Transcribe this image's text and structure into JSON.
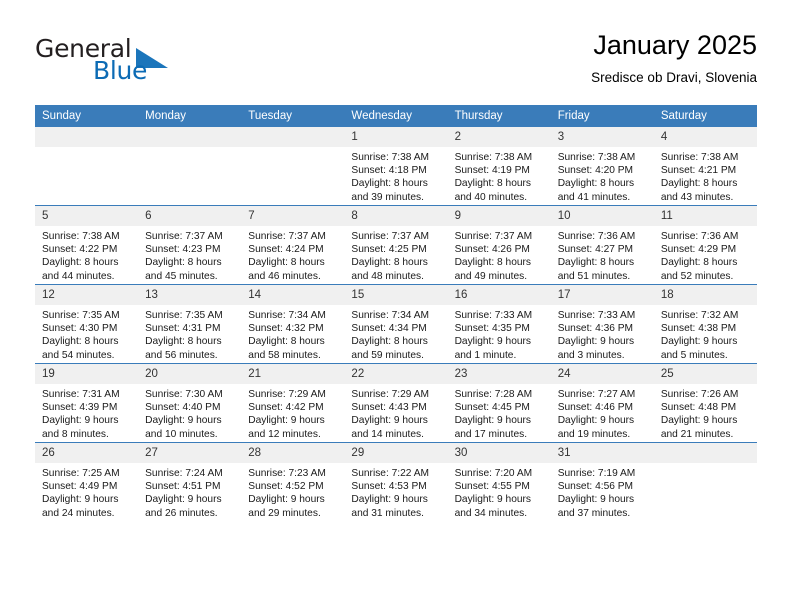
{
  "brand": {
    "name_part1": "General",
    "name_part2": "Blue",
    "accent_color": "#1b75bb"
  },
  "header": {
    "title": "January 2025",
    "subtitle": "Sredisce ob Dravi, Slovenia"
  },
  "theme": {
    "header_row_bg": "#3a7cba",
    "daynum_bg": "#f0f0f0",
    "page_bg": "#ffffff"
  },
  "weekdays": [
    "Sunday",
    "Monday",
    "Tuesday",
    "Wednesday",
    "Thursday",
    "Friday",
    "Saturday"
  ],
  "weeks": [
    [
      {
        "empty": true
      },
      {
        "empty": true
      },
      {
        "empty": true
      },
      {
        "day": "1",
        "sunrise": "Sunrise: 7:38 AM",
        "sunset": "Sunset: 4:18 PM",
        "daylight1": "Daylight: 8 hours",
        "daylight2": "and 39 minutes."
      },
      {
        "day": "2",
        "sunrise": "Sunrise: 7:38 AM",
        "sunset": "Sunset: 4:19 PM",
        "daylight1": "Daylight: 8 hours",
        "daylight2": "and 40 minutes."
      },
      {
        "day": "3",
        "sunrise": "Sunrise: 7:38 AM",
        "sunset": "Sunset: 4:20 PM",
        "daylight1": "Daylight: 8 hours",
        "daylight2": "and 41 minutes."
      },
      {
        "day": "4",
        "sunrise": "Sunrise: 7:38 AM",
        "sunset": "Sunset: 4:21 PM",
        "daylight1": "Daylight: 8 hours",
        "daylight2": "and 43 minutes."
      }
    ],
    [
      {
        "day": "5",
        "sunrise": "Sunrise: 7:38 AM",
        "sunset": "Sunset: 4:22 PM",
        "daylight1": "Daylight: 8 hours",
        "daylight2": "and 44 minutes."
      },
      {
        "day": "6",
        "sunrise": "Sunrise: 7:37 AM",
        "sunset": "Sunset: 4:23 PM",
        "daylight1": "Daylight: 8 hours",
        "daylight2": "and 45 minutes."
      },
      {
        "day": "7",
        "sunrise": "Sunrise: 7:37 AM",
        "sunset": "Sunset: 4:24 PM",
        "daylight1": "Daylight: 8 hours",
        "daylight2": "and 46 minutes."
      },
      {
        "day": "8",
        "sunrise": "Sunrise: 7:37 AM",
        "sunset": "Sunset: 4:25 PM",
        "daylight1": "Daylight: 8 hours",
        "daylight2": "and 48 minutes."
      },
      {
        "day": "9",
        "sunrise": "Sunrise: 7:37 AM",
        "sunset": "Sunset: 4:26 PM",
        "daylight1": "Daylight: 8 hours",
        "daylight2": "and 49 minutes."
      },
      {
        "day": "10",
        "sunrise": "Sunrise: 7:36 AM",
        "sunset": "Sunset: 4:27 PM",
        "daylight1": "Daylight: 8 hours",
        "daylight2": "and 51 minutes."
      },
      {
        "day": "11",
        "sunrise": "Sunrise: 7:36 AM",
        "sunset": "Sunset: 4:29 PM",
        "daylight1": "Daylight: 8 hours",
        "daylight2": "and 52 minutes."
      }
    ],
    [
      {
        "day": "12",
        "sunrise": "Sunrise: 7:35 AM",
        "sunset": "Sunset: 4:30 PM",
        "daylight1": "Daylight: 8 hours",
        "daylight2": "and 54 minutes."
      },
      {
        "day": "13",
        "sunrise": "Sunrise: 7:35 AM",
        "sunset": "Sunset: 4:31 PM",
        "daylight1": "Daylight: 8 hours",
        "daylight2": "and 56 minutes."
      },
      {
        "day": "14",
        "sunrise": "Sunrise: 7:34 AM",
        "sunset": "Sunset: 4:32 PM",
        "daylight1": "Daylight: 8 hours",
        "daylight2": "and 58 minutes."
      },
      {
        "day": "15",
        "sunrise": "Sunrise: 7:34 AM",
        "sunset": "Sunset: 4:34 PM",
        "daylight1": "Daylight: 8 hours",
        "daylight2": "and 59 minutes."
      },
      {
        "day": "16",
        "sunrise": "Sunrise: 7:33 AM",
        "sunset": "Sunset: 4:35 PM",
        "daylight1": "Daylight: 9 hours",
        "daylight2": "and 1 minute."
      },
      {
        "day": "17",
        "sunrise": "Sunrise: 7:33 AM",
        "sunset": "Sunset: 4:36 PM",
        "daylight1": "Daylight: 9 hours",
        "daylight2": "and 3 minutes."
      },
      {
        "day": "18",
        "sunrise": "Sunrise: 7:32 AM",
        "sunset": "Sunset: 4:38 PM",
        "daylight1": "Daylight: 9 hours",
        "daylight2": "and 5 minutes."
      }
    ],
    [
      {
        "day": "19",
        "sunrise": "Sunrise: 7:31 AM",
        "sunset": "Sunset: 4:39 PM",
        "daylight1": "Daylight: 9 hours",
        "daylight2": "and 8 minutes."
      },
      {
        "day": "20",
        "sunrise": "Sunrise: 7:30 AM",
        "sunset": "Sunset: 4:40 PM",
        "daylight1": "Daylight: 9 hours",
        "daylight2": "and 10 minutes."
      },
      {
        "day": "21",
        "sunrise": "Sunrise: 7:29 AM",
        "sunset": "Sunset: 4:42 PM",
        "daylight1": "Daylight: 9 hours",
        "daylight2": "and 12 minutes."
      },
      {
        "day": "22",
        "sunrise": "Sunrise: 7:29 AM",
        "sunset": "Sunset: 4:43 PM",
        "daylight1": "Daylight: 9 hours",
        "daylight2": "and 14 minutes."
      },
      {
        "day": "23",
        "sunrise": "Sunrise: 7:28 AM",
        "sunset": "Sunset: 4:45 PM",
        "daylight1": "Daylight: 9 hours",
        "daylight2": "and 17 minutes."
      },
      {
        "day": "24",
        "sunrise": "Sunrise: 7:27 AM",
        "sunset": "Sunset: 4:46 PM",
        "daylight1": "Daylight: 9 hours",
        "daylight2": "and 19 minutes."
      },
      {
        "day": "25",
        "sunrise": "Sunrise: 7:26 AM",
        "sunset": "Sunset: 4:48 PM",
        "daylight1": "Daylight: 9 hours",
        "daylight2": "and 21 minutes."
      }
    ],
    [
      {
        "day": "26",
        "sunrise": "Sunrise: 7:25 AM",
        "sunset": "Sunset: 4:49 PM",
        "daylight1": "Daylight: 9 hours",
        "daylight2": "and 24 minutes."
      },
      {
        "day": "27",
        "sunrise": "Sunrise: 7:24 AM",
        "sunset": "Sunset: 4:51 PM",
        "daylight1": "Daylight: 9 hours",
        "daylight2": "and 26 minutes."
      },
      {
        "day": "28",
        "sunrise": "Sunrise: 7:23 AM",
        "sunset": "Sunset: 4:52 PM",
        "daylight1": "Daylight: 9 hours",
        "daylight2": "and 29 minutes."
      },
      {
        "day": "29",
        "sunrise": "Sunrise: 7:22 AM",
        "sunset": "Sunset: 4:53 PM",
        "daylight1": "Daylight: 9 hours",
        "daylight2": "and 31 minutes."
      },
      {
        "day": "30",
        "sunrise": "Sunrise: 7:20 AM",
        "sunset": "Sunset: 4:55 PM",
        "daylight1": "Daylight: 9 hours",
        "daylight2": "and 34 minutes."
      },
      {
        "day": "31",
        "sunrise": "Sunrise: 7:19 AM",
        "sunset": "Sunset: 4:56 PM",
        "daylight1": "Daylight: 9 hours",
        "daylight2": "and 37 minutes."
      },
      {
        "empty": true
      }
    ]
  ]
}
